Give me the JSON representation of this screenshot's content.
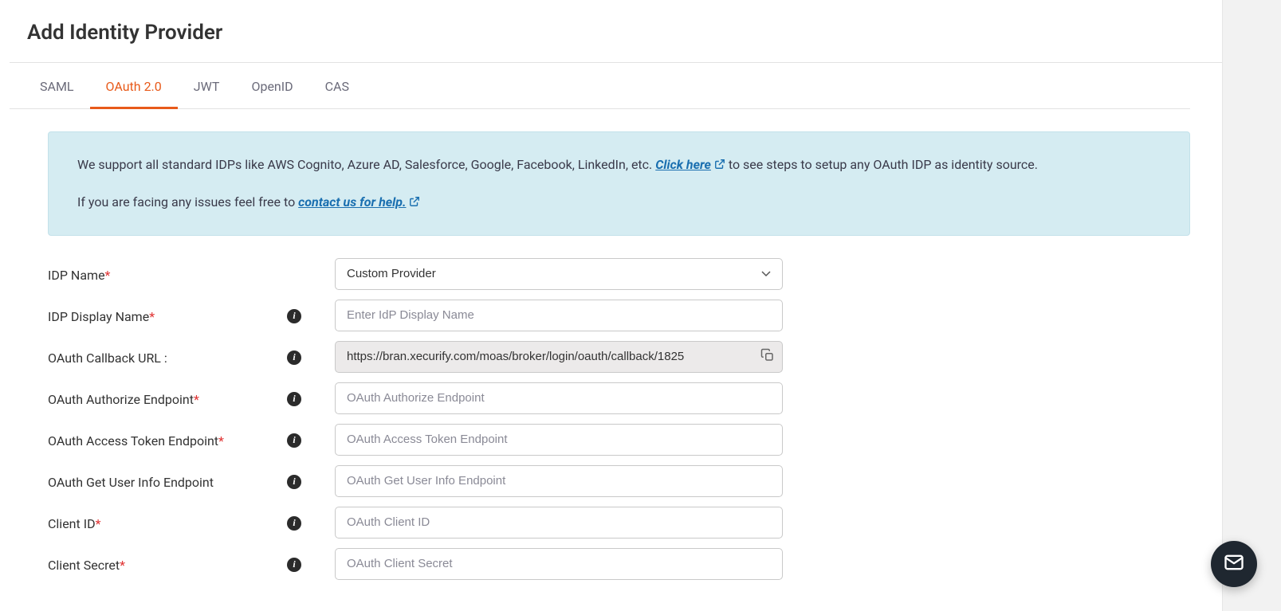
{
  "page": {
    "title": "Add Identity Provider"
  },
  "tabs": [
    {
      "label": "SAML"
    },
    {
      "label": "OAuth 2.0"
    },
    {
      "label": "JWT"
    },
    {
      "label": "OpenID"
    },
    {
      "label": "CAS"
    }
  ],
  "banner": {
    "text1": "We support all standard IDPs like AWS Cognito, Azure AD, Salesforce, Google, Facebook, LinkedIn, etc. ",
    "link1": "Click here",
    "text2": " to see steps to setup any OAuth IDP as identity source.",
    "text3": "If you are facing any issues feel free to ",
    "link2": "contact us for help."
  },
  "form": {
    "idp_name_label": "IDP Name",
    "idp_name_value": "Custom Provider",
    "idp_display_name_label": "IDP Display Name",
    "idp_display_name_placeholder": "Enter IdP Display Name",
    "callback_label": "OAuth Callback URL :",
    "callback_value": "https://bran.xecurify.com/moas/broker/login/oauth/callback/1825",
    "authorize_label": "OAuth Authorize Endpoint",
    "authorize_placeholder": "OAuth Authorize Endpoint",
    "token_label": "OAuth Access Token Endpoint",
    "token_placeholder": "OAuth Access Token Endpoint",
    "userinfo_label": "OAuth Get User Info Endpoint",
    "userinfo_placeholder": "OAuth Get User Info Endpoint",
    "client_id_label": "Client ID",
    "client_id_placeholder": "OAuth Client ID",
    "client_secret_label": "Client Secret",
    "client_secret_placeholder": "OAuth Client Secret"
  }
}
